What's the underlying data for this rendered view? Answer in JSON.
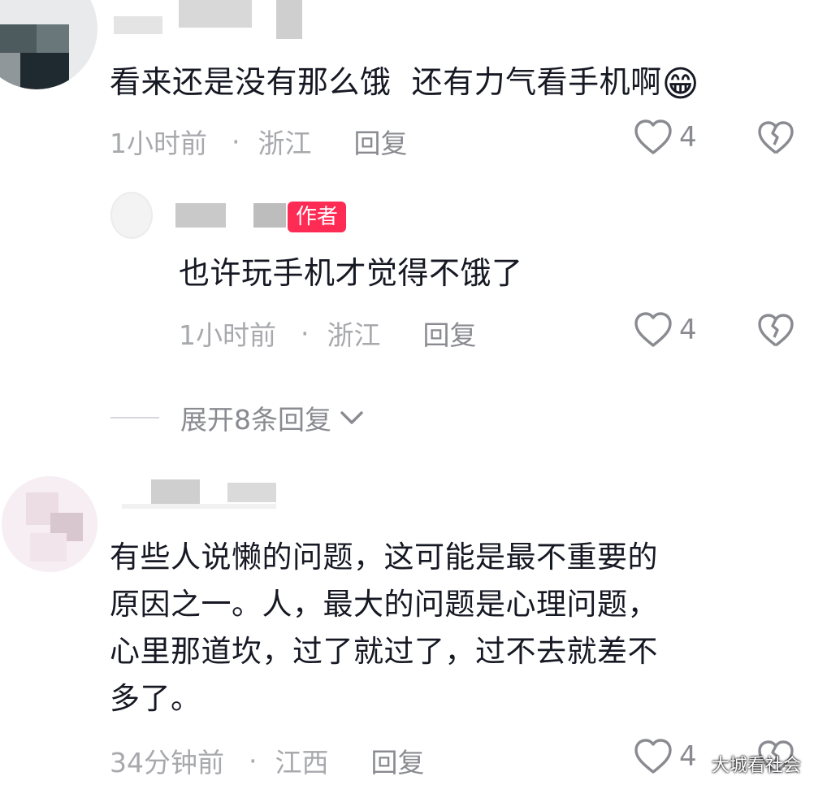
{
  "comments": [
    {
      "text": "看来还是没有那么饿  还有力气看手机啊",
      "emoji": "😁",
      "time": "1小时前",
      "location": "浙江",
      "reply_label": "回复",
      "likes": "4",
      "reply": {
        "author_tag": "作者",
        "text": "也许玩手机才觉得不饿了",
        "time": "1小时前",
        "location": "浙江",
        "reply_label": "回复",
        "likes": "4"
      },
      "expand_label": "展开8条回复"
    },
    {
      "text_lines": [
        "有些人说懒的问题，这可能是最不重要的",
        "原因之一。人，最大的问题是心理问题，",
        "心里那道坎，过了就过了，过不去就差不",
        "多了。"
      ],
      "time": "34分钟前",
      "location": "江西",
      "reply_label": "回复",
      "likes": "4"
    }
  ],
  "separator": "·",
  "watermark": "大城看社会",
  "icons": {
    "like": "heart-outline-icon",
    "dislike": "broken-heart-icon",
    "expand": "chevron-down-icon"
  },
  "colors": {
    "author_tag": "#fe2c55",
    "meta": "#a8a9ad",
    "text": "#161823"
  }
}
